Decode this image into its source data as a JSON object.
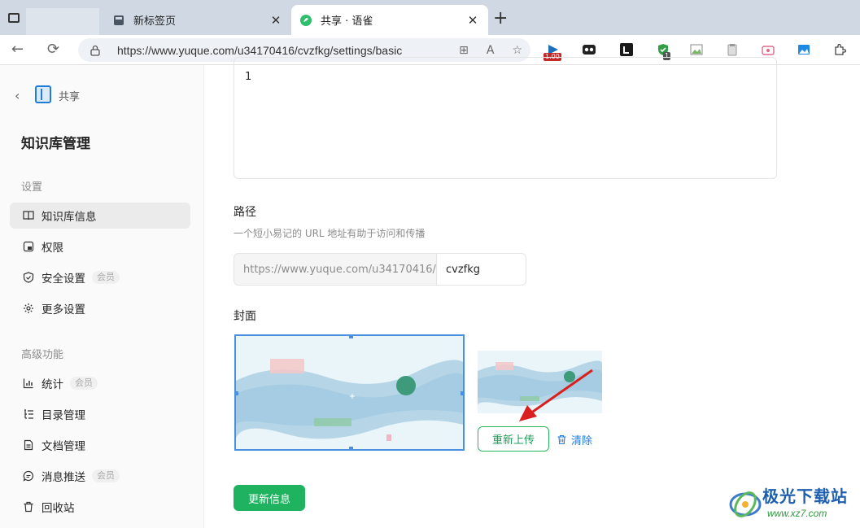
{
  "browser": {
    "tabs": [
      {
        "title": "新标签页",
        "active": false
      },
      {
        "title": "共享 · 语雀",
        "active": true
      }
    ],
    "url": "https://www.yuque.com/u34170416/cvzfkg/settings/basic",
    "extensions": {
      "badge_price": "1.00",
      "badge_count": "1"
    }
  },
  "sidebar": {
    "book_name": "共享",
    "title": "知识库管理",
    "group_settings": "设置",
    "group_advanced": "高级功能",
    "member_badge": "会员",
    "items": [
      {
        "label": "知识库信息",
        "icon": "book-open-icon",
        "active": true,
        "member": false
      },
      {
        "label": "权限",
        "icon": "permission-icon",
        "active": false,
        "member": false
      },
      {
        "label": "安全设置",
        "icon": "shield-icon",
        "active": false,
        "member": true
      },
      {
        "label": "更多设置",
        "icon": "gear-icon",
        "active": false,
        "member": false
      },
      {
        "label": "统计",
        "icon": "bar-chart-icon",
        "active": false,
        "member": true
      },
      {
        "label": "目录管理",
        "icon": "toc-icon",
        "active": false,
        "member": false
      },
      {
        "label": "文档管理",
        "icon": "document-icon",
        "active": false,
        "member": false
      },
      {
        "label": "消息推送",
        "icon": "message-icon",
        "active": false,
        "member": true
      },
      {
        "label": "回收站",
        "icon": "trash-icon",
        "active": false,
        "member": false
      }
    ]
  },
  "main": {
    "description_value": "1",
    "path_label": "路径",
    "path_hint": "一个短小易记的 URL 地址有助于访问和传播",
    "path_prefix": "https://www.yuque.com/u34170416/",
    "path_value": "cvzfkg",
    "cover_label": "封面",
    "reupload_label": "重新上传",
    "clear_label": "清除",
    "update_label": "更新信息"
  },
  "watermark": {
    "name": "极光下载站",
    "url": "www.xz7.com"
  },
  "colors": {
    "accent_green": "#1fb360",
    "link_blue": "#1f7cd9",
    "annotation_arrow": "#d9201f"
  }
}
